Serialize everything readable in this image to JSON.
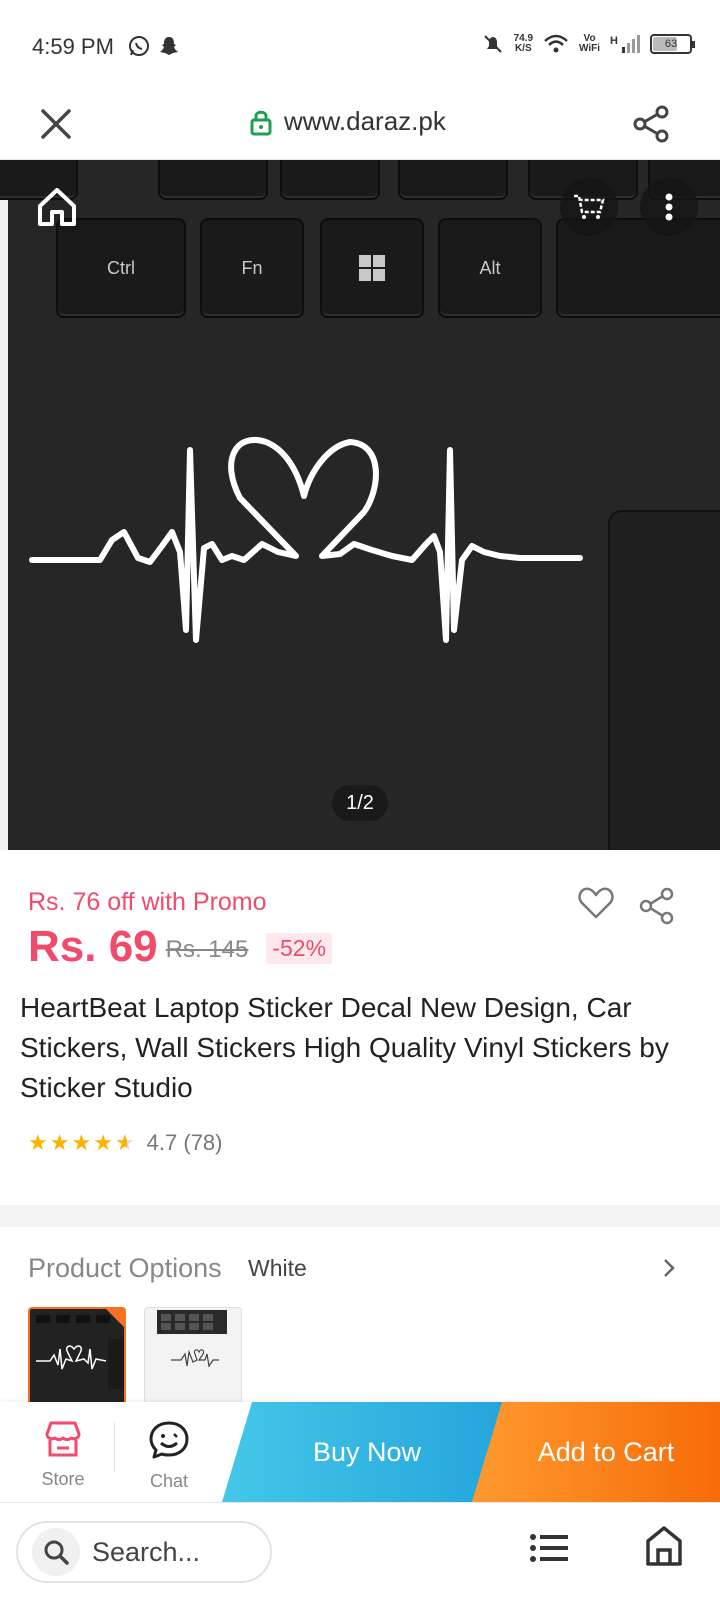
{
  "status_bar": {
    "time": "4:59 PM",
    "net_speed_value": "74.9",
    "net_speed_unit": "K/S",
    "vowifi_top": "Vo",
    "vowifi_bottom": "WiFi",
    "network": "H",
    "battery": "63"
  },
  "url_bar": {
    "url": "www.daraz.pk"
  },
  "hero": {
    "keys": [
      "Ctrl",
      "Fn",
      "Alt"
    ],
    "pager": "1/2"
  },
  "product": {
    "promo": "Rs. 76 off with Promo",
    "price": "Rs. 69",
    "old_price": "Rs. 145",
    "discount": "-52%",
    "title": "HeartBeat Laptop Sticker Decal New Design, Car Stickers, Wall Stickers High Quality Vinyl Stickers by Sticker Studio",
    "rating_value": "4.7 (78)",
    "rating": 4.7
  },
  "options": {
    "label": "Product Options",
    "value": "White"
  },
  "action_bar": {
    "store_label": "Store",
    "chat_label": "Chat",
    "buy_now": "Buy Now",
    "add_to_cart": "Add to Cart",
    "buy_now_colors": [
      "#44c7e8",
      "#23a4dc"
    ],
    "add_to_cart_colors": [
      "#ff9a2e",
      "#f76b08"
    ]
  },
  "bottom_bar": {
    "search_placeholder": "Search..."
  },
  "colors": {
    "accent_pink": "#f24a6b",
    "accent_orange": "#f57224",
    "star": "#fbb300"
  }
}
